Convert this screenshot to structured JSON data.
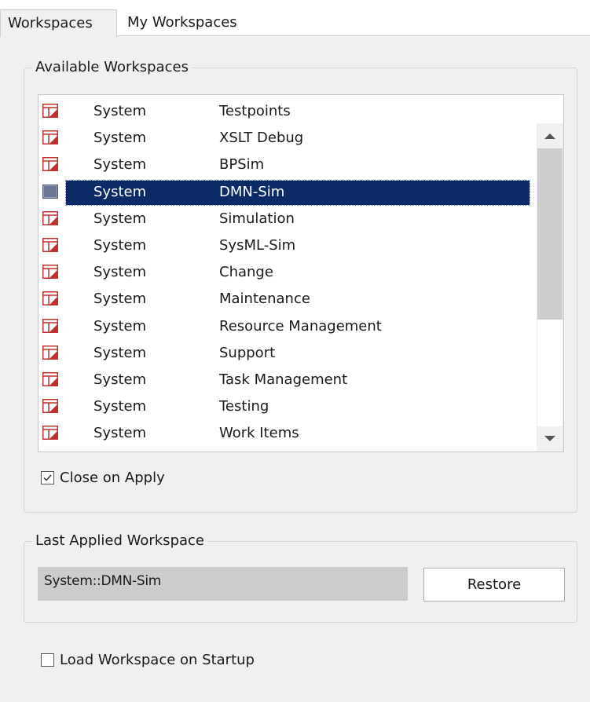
{
  "tabs": [
    {
      "label": "Workspaces",
      "active": true
    },
    {
      "label": "My Workspaces",
      "active": false
    }
  ],
  "available_group": {
    "legend": "Available Workspaces",
    "rows": [
      {
        "col1": "System",
        "col2": "Testpoints",
        "selected": false
      },
      {
        "col1": "System",
        "col2": "XSLT Debug",
        "selected": false
      },
      {
        "col1": "System",
        "col2": "BPSim",
        "selected": false
      },
      {
        "col1": "System",
        "col2": "DMN-Sim",
        "selected": true
      },
      {
        "col1": "System",
        "col2": "Simulation",
        "selected": false
      },
      {
        "col1": "System",
        "col2": "SysML-Sim",
        "selected": false
      },
      {
        "col1": "System",
        "col2": "Change",
        "selected": false
      },
      {
        "col1": "System",
        "col2": "Maintenance",
        "selected": false
      },
      {
        "col1": "System",
        "col2": "Resource Management",
        "selected": false
      },
      {
        "col1": "System",
        "col2": "Support",
        "selected": false
      },
      {
        "col1": "System",
        "col2": "Task Management",
        "selected": false
      },
      {
        "col1": "System",
        "col2": "Testing",
        "selected": false
      },
      {
        "col1": "System",
        "col2": "Work Items",
        "selected": false
      }
    ],
    "close_on_apply": {
      "label": "Close on Apply",
      "checked": true
    }
  },
  "last_applied_group": {
    "legend": "Last Applied Workspace",
    "value": "System::DMN-Sim",
    "restore_label": "Restore"
  },
  "load_on_startup": {
    "label": "Load Workspace on Startup",
    "checked": false
  },
  "colors": {
    "selection": "#0c2b66",
    "icon_red": "#c0302e",
    "background": "#f0f0f0",
    "field_gray": "#cccccc"
  },
  "icons": {
    "workspace": "workspace-layout-icon",
    "scroll_up": "scroll-up-arrow-icon",
    "scroll_down": "scroll-down-arrow-icon",
    "check": "checkmark-icon"
  }
}
